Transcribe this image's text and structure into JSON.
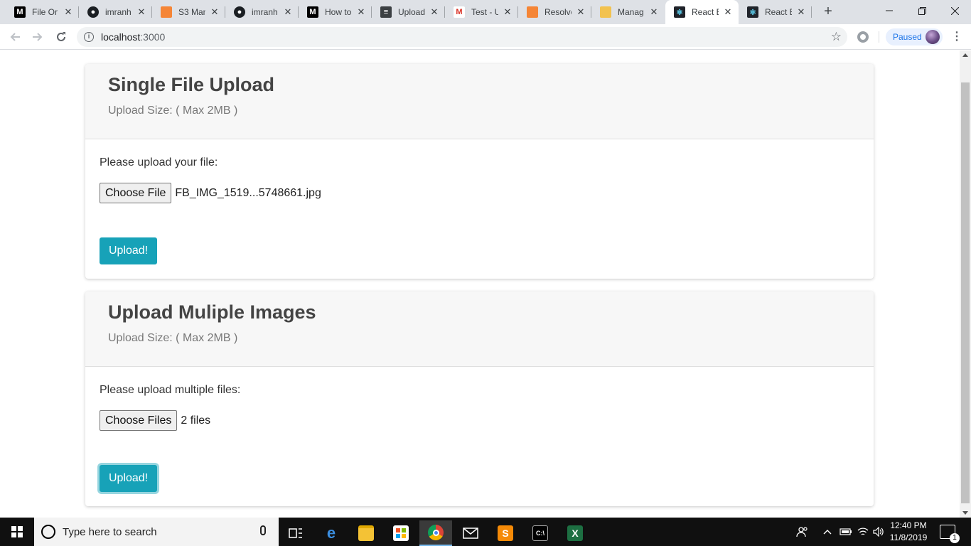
{
  "browser": {
    "tabs": [
      {
        "title": "File Or",
        "icon": "medium-icon",
        "active": false
      },
      {
        "title": "imranh",
        "icon": "github-icon",
        "active": false
      },
      {
        "title": "S3 Man",
        "icon": "aws-icon",
        "active": false
      },
      {
        "title": "imranh",
        "icon": "github-icon",
        "active": false
      },
      {
        "title": "How to",
        "icon": "medium-icon",
        "active": false
      },
      {
        "title": "Upload",
        "icon": "document-icon",
        "active": false
      },
      {
        "title": "Test - U",
        "icon": "gmail-icon",
        "active": false
      },
      {
        "title": "Resolve",
        "icon": "aws-icon",
        "active": false
      },
      {
        "title": "Manag",
        "icon": "box-icon",
        "active": false
      },
      {
        "title": "React B",
        "icon": "react-icon",
        "active": true
      },
      {
        "title": "React B",
        "icon": "react-icon",
        "active": false
      }
    ],
    "url_host": "localhost",
    "url_port": ":3000",
    "profile_status": "Paused"
  },
  "page": {
    "single": {
      "title": "Single File Upload",
      "subtitle": "Upload Size: ( Max 2MB )",
      "field_label": "Please upload your file:",
      "choose_label": "Choose File",
      "chosen_text": "FB_IMG_1519...5748661.jpg",
      "upload_label": "Upload!"
    },
    "multiple": {
      "title": "Upload Muliple Images",
      "subtitle": "Upload Size: ( Max 2MB )",
      "field_label": "Please upload multiple files:",
      "choose_label": "Choose Files",
      "chosen_text": "2 files",
      "upload_label": "Upload!"
    }
  },
  "taskbar": {
    "search_placeholder": "Type here to search",
    "time": "12:40 PM",
    "date": "11/8/2019",
    "notification_count": "1"
  },
  "colors": {
    "accent": "#17a2b8",
    "header_bg": "#f7f7f7"
  }
}
